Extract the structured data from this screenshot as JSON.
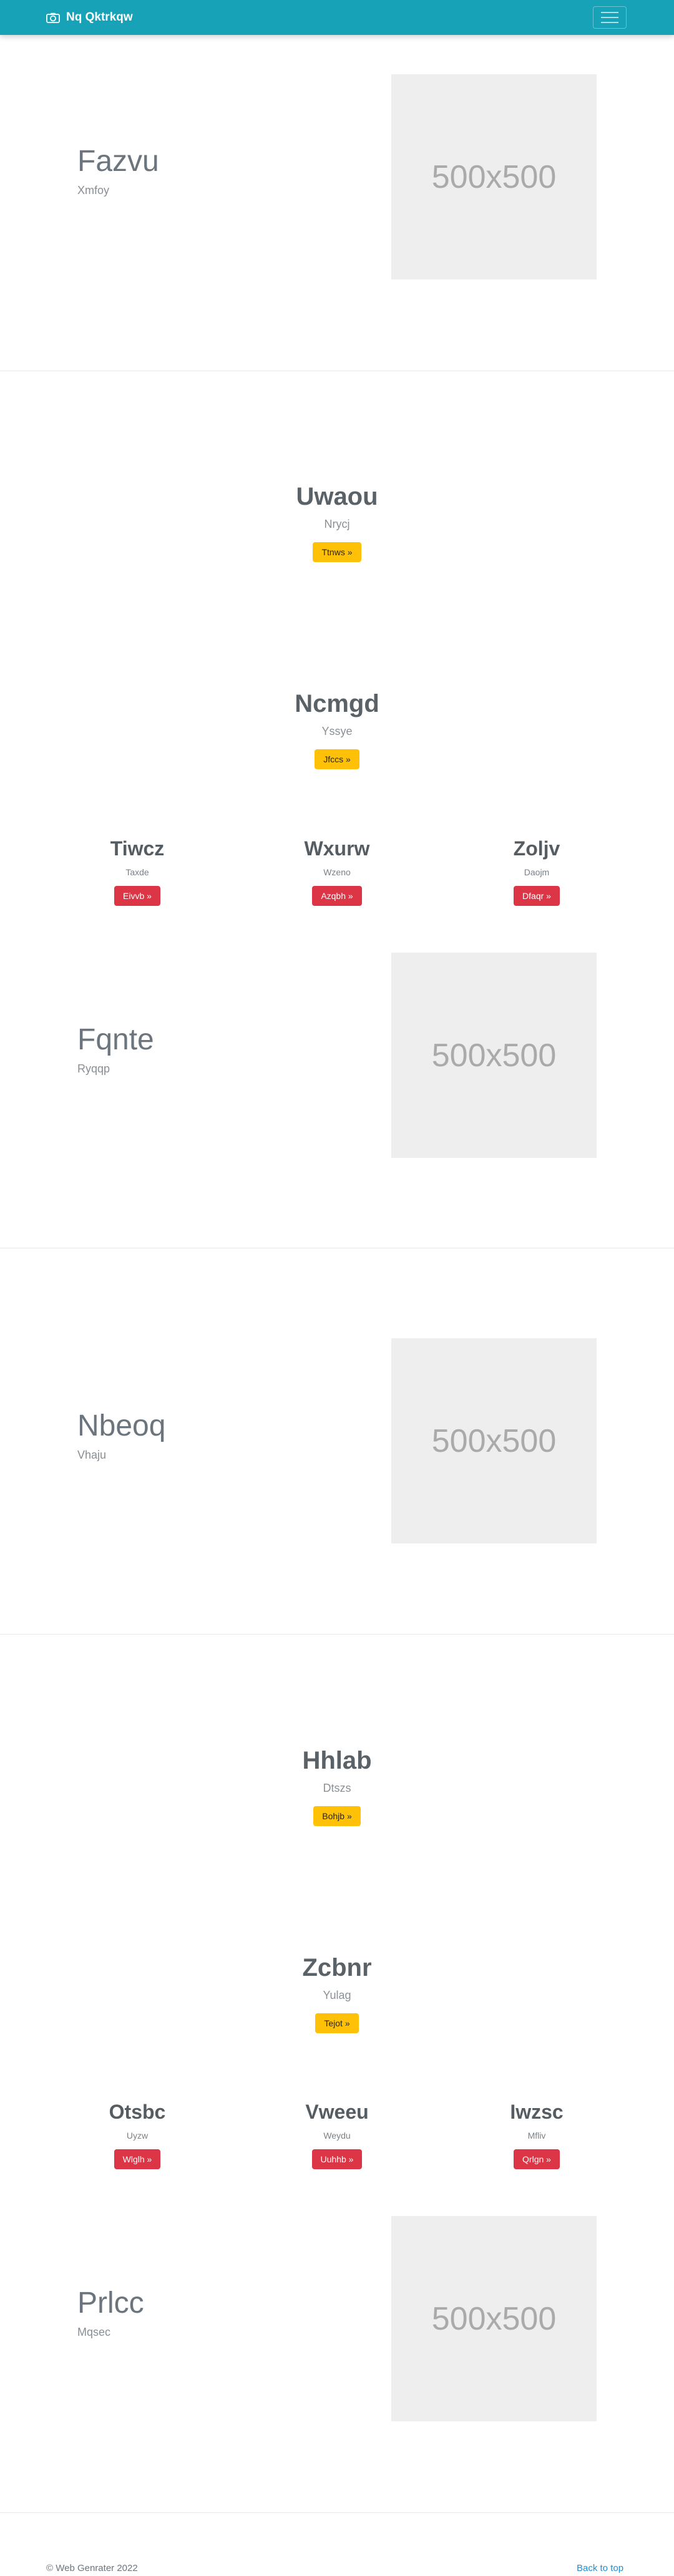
{
  "navbar": {
    "brand": "Nq Qktrkqw",
    "brand_icon": "camera-icon",
    "toggler_icon": "hamburger-icon"
  },
  "hero1": {
    "title": "Fazvu",
    "subtitle": "Xmfoy",
    "image_text": "500x500"
  },
  "cta1": {
    "title": "Uwaou",
    "subtitle": "Nrycj",
    "button": "Ttnws »"
  },
  "cta2": {
    "title": "Ncmgd",
    "subtitle": "Yssye",
    "button": "Jfccs »"
  },
  "features1": [
    {
      "title": "Tiwcz",
      "subtitle": "Taxde",
      "button": "Eivvb »"
    },
    {
      "title": "Wxurw",
      "subtitle": "Wzeno",
      "button": "Azqbh »"
    },
    {
      "title": "Zoljv",
      "subtitle": "Daojm",
      "button": "Dfaqr »"
    }
  ],
  "hero2": {
    "title": "Fqnte",
    "subtitle": "Ryqqp",
    "image_text": "500x500"
  },
  "hero3": {
    "title": "Nbeoq",
    "subtitle": "Vhaju",
    "image_text": "500x500"
  },
  "cta3": {
    "title": "Hhlab",
    "subtitle": "Dtszs",
    "button": "Bohjb »"
  },
  "cta4": {
    "title": "Zcbnr",
    "subtitle": "Yulag",
    "button": "Tejot »"
  },
  "features2": [
    {
      "title": "Otsbc",
      "subtitle": "Uyzw",
      "button": "Wlglh »"
    },
    {
      "title": "Vweeu",
      "subtitle": "Weydu",
      "button": "Uuhhb »"
    },
    {
      "title": "Iwzsc",
      "subtitle": "Mfliv",
      "button": "Qrlgn »"
    }
  ],
  "hero4": {
    "title": "Prlcc",
    "subtitle": "Mqsec",
    "image_text": "500x500"
  },
  "footer": {
    "copyright": "© Web Genrater 2022",
    "back_to_top": "Back to top"
  },
  "colors": {
    "navbar": "#17a2b8",
    "warning": "#ffc107",
    "danger": "#dc3545",
    "link": "#1e8fd6"
  }
}
